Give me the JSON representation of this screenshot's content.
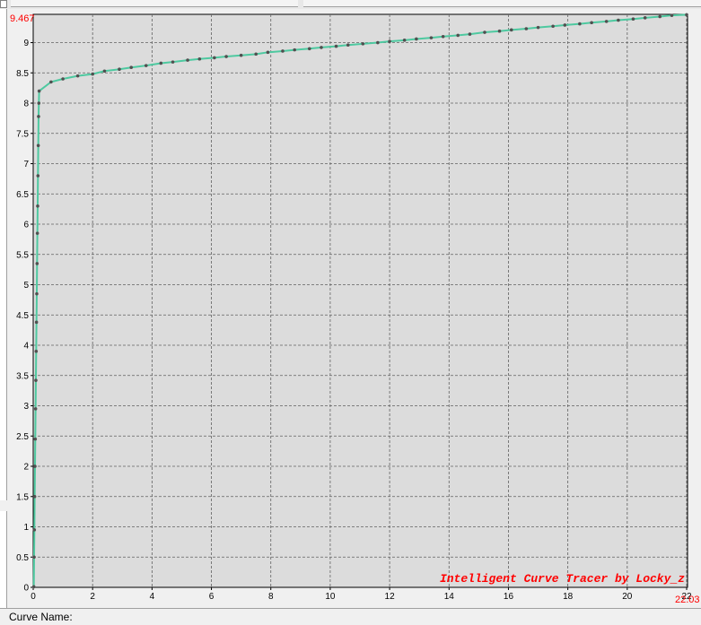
{
  "status_bar": {
    "label": "Curve Name:"
  },
  "chart_data": {
    "type": "line",
    "title": "",
    "xlabel": "",
    "ylabel": "",
    "xlim": [
      0,
      22.03
    ],
    "ylim": [
      0,
      9.467
    ],
    "x_max_label": "22.03",
    "y_max_label": "9.467",
    "x_ticks": [
      0,
      2,
      4,
      6,
      8,
      10,
      12,
      14,
      16,
      18,
      20,
      22
    ],
    "x_tick_labels": [
      "0",
      "2",
      "4",
      "6",
      "8",
      "10",
      "12",
      "14",
      "16",
      "18",
      "20",
      "22"
    ],
    "y_ticks": [
      0,
      0.5,
      1,
      1.5,
      2,
      2.5,
      3,
      3.5,
      4,
      4.5,
      5,
      5.5,
      6,
      6.5,
      7,
      7.5,
      8,
      8.5,
      9
    ],
    "y_tick_labels": [
      "0",
      "0.5",
      "1",
      "1.5",
      "2",
      "2.5",
      "3",
      "3.5",
      "4",
      "4.5",
      "5",
      "5.5",
      "6",
      "6.5",
      "7",
      "7.5",
      "8",
      "8.5",
      "9"
    ],
    "grid": true,
    "annotation": "Intelligent Curve Tracer by Locky_z",
    "colors": {
      "line": "#4ec9a0",
      "marker": "#505050",
      "plot_bg": "#dcdcdc",
      "grid": "#606060",
      "red_text": "#ff0000"
    },
    "series": [
      {
        "x": [
          0.02,
          0.03,
          0.04,
          0.05,
          0.06,
          0.07,
          0.08,
          0.09,
          0.1,
          0.11,
          0.12,
          0.13,
          0.14,
          0.15,
          0.16,
          0.17,
          0.18,
          0.19,
          0.2,
          0.6,
          1.0,
          1.5,
          2.0,
          2.4,
          2.9,
          3.3,
          3.8,
          4.3,
          4.7,
          5.2,
          5.6,
          6.1,
          6.5,
          7.0,
          7.5,
          7.9,
          8.4,
          8.8,
          9.3,
          9.7,
          10.2,
          10.6,
          11.1,
          11.6,
          12.0,
          12.5,
          12.9,
          13.4,
          13.8,
          14.3,
          14.7,
          15.2,
          15.7,
          16.1,
          16.6,
          17.0,
          17.5,
          17.9,
          18.4,
          18.8,
          19.3,
          19.7,
          20.2,
          20.6,
          21.1,
          21.5,
          22.0
        ],
        "y": [
          0.01,
          0.5,
          0.95,
          1.5,
          2.0,
          2.45,
          2.95,
          3.42,
          3.9,
          4.38,
          4.85,
          5.35,
          5.85,
          6.3,
          6.8,
          7.3,
          7.78,
          8.0,
          8.2,
          8.35,
          8.4,
          8.45,
          8.48,
          8.53,
          8.56,
          8.59,
          8.62,
          8.66,
          8.68,
          8.71,
          8.73,
          8.75,
          8.77,
          8.79,
          8.81,
          8.84,
          8.86,
          8.88,
          8.9,
          8.92,
          8.94,
          8.96,
          8.98,
          9.0,
          9.02,
          9.04,
          9.06,
          9.08,
          9.1,
          9.12,
          9.14,
          9.17,
          9.19,
          9.21,
          9.23,
          9.25,
          9.27,
          9.29,
          9.31,
          9.33,
          9.35,
          9.37,
          9.39,
          9.41,
          9.43,
          9.45,
          9.46
        ]
      }
    ]
  }
}
